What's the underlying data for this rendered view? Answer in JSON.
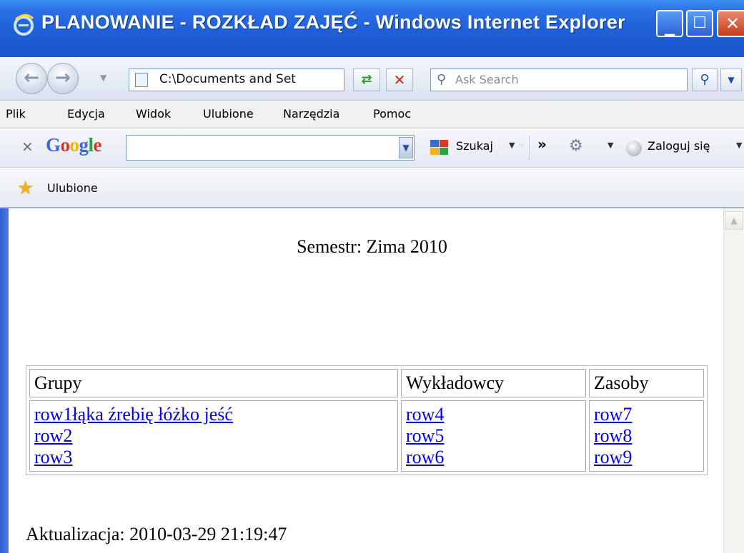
{
  "window": {
    "title": "PLANOWANIE - ROZKŁAD ZAJĘĆ - Windows Internet Explorer",
    "buttons": {
      "minimize": "_",
      "maximize": "□",
      "close": "X"
    }
  },
  "navbar": {
    "address": "C:\\Documents and Set",
    "search_placeholder": "Ask Search"
  },
  "menu": [
    "Plik",
    "Edycja",
    "Widok",
    "Ulubione",
    "Narzędzia",
    "Pomoc"
  ],
  "google_toolbar": {
    "logo": "Google",
    "search_button": "Szukaj",
    "sign_in": "Zaloguj się"
  },
  "favorites": {
    "label": "Ulubione"
  },
  "page": {
    "semester": "Semestr: Zima 2010",
    "table": {
      "headers": [
        "Grupy",
        "Wykładowcy",
        "Zasoby"
      ],
      "grupy": [
        "row1łąka źrebię łóżko jeść",
        "row2",
        "row3"
      ],
      "wykladowcy": [
        "row4",
        "row5",
        "row6"
      ],
      "zasoby": [
        "row7",
        "row8",
        "row9"
      ]
    },
    "updated": "Aktualizacja: 2010-03-29 21:19:47"
  }
}
